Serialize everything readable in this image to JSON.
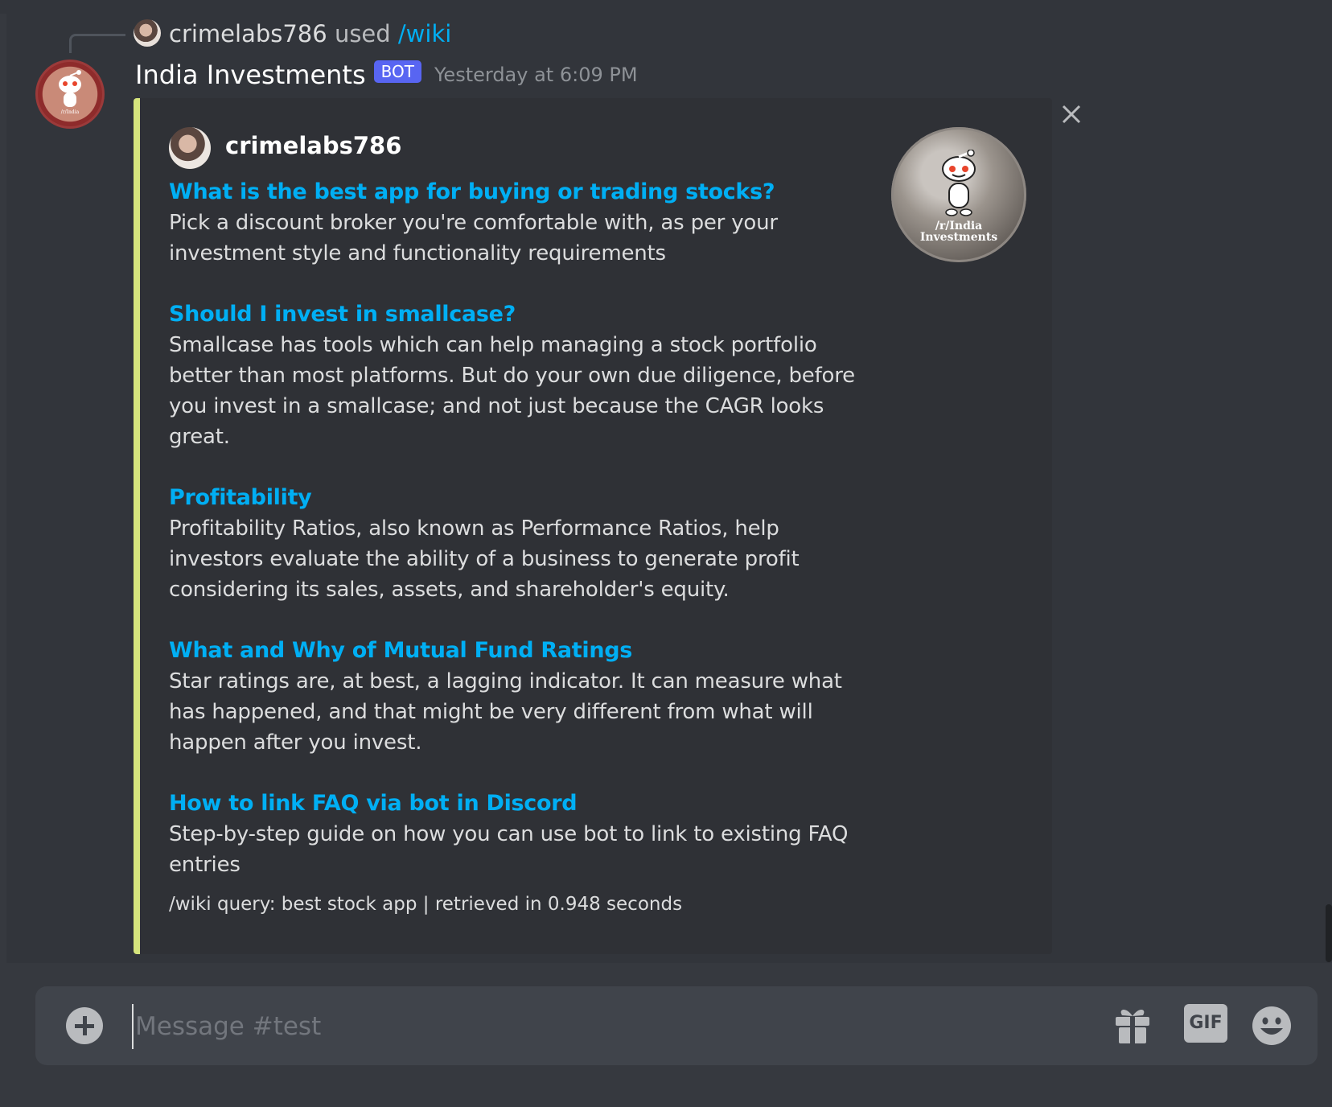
{
  "reply": {
    "user": "crimelabs786",
    "verb": "used",
    "command": "/wiki"
  },
  "message": {
    "author": "India Investments",
    "tag": "BOT",
    "timestamp": "Yesterday at 6:09 PM"
  },
  "embed": {
    "author": "crimelabs786",
    "accent_color": "#d6e57d",
    "thumbnail_text": [
      "/r/India",
      "Investments"
    ],
    "fields": [
      {
        "title": "What is the best app for buying or trading stocks?",
        "description": "Pick a discount broker you're comfortable with, as per your investment style and functionality requirements"
      },
      {
        "title": "Should I invest in smallcase?",
        "description": "Smallcase has tools which can help managing a stock portfolio better than most platforms. But do your own due diligence, before you invest in a smallcase; and not just because the CAGR looks great."
      },
      {
        "title": "Profitability",
        "description": "Profitability Ratios, also known as Performance Ratios, help investors evaluate the ability of a business to generate profit considering its sales, assets, and shareholder's equity."
      },
      {
        "title": "What and Why of Mutual Fund Ratings",
        "description": "Star ratings are, at best, a lagging indicator. It can measure what has happened, and that might be very different from what will happen after you invest."
      },
      {
        "title": "How to link FAQ via bot in Discord",
        "description": "Step-by-step guide on how you can use bot to link to existing FAQ entries"
      }
    ],
    "footer": "/wiki query: best stock app | retrieved in 0.948 seconds"
  },
  "composer": {
    "placeholder": "Message #test",
    "gif_label": "GIF"
  },
  "icons": {
    "close": "close-icon",
    "add": "plus-circle-icon",
    "gift": "gift-icon",
    "gif": "gif-icon",
    "emoji": "emoji-icon"
  },
  "colors": {
    "link": "#00aff4",
    "bot_tag": "#5865f2",
    "background": "#36393f",
    "embed_background": "#2f3136"
  }
}
